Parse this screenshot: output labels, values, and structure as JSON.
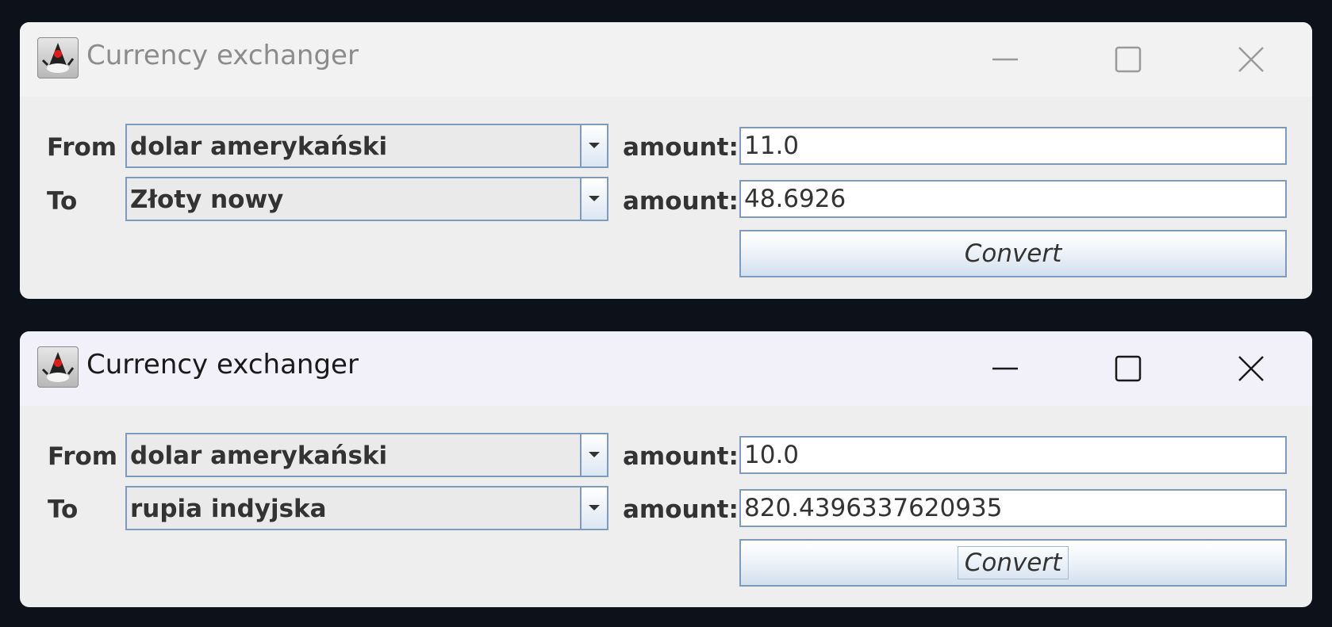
{
  "windows": [
    {
      "title": "Currency exchanger",
      "active": false,
      "from_label": "From",
      "to_label": "To",
      "from_currency": "dolar amerykański",
      "to_currency": "Złoty nowy",
      "amount_label": "amount:",
      "from_amount": "11.0",
      "to_amount": "48.6926",
      "convert_label": "Convert"
    },
    {
      "title": "Currency exchanger",
      "active": true,
      "from_label": "From",
      "to_label": "To",
      "from_currency": "dolar amerykański",
      "to_currency": "rupia indyjska",
      "amount_label": "amount:",
      "from_amount": "10.0",
      "to_amount": "820.4396337620935",
      "convert_label": "Convert"
    }
  ],
  "icons": {
    "app": "java-duke-icon",
    "minimize": "minimize-icon",
    "maximize": "maximize-icon",
    "close": "close-icon",
    "dropdown": "chevron-down-icon"
  },
  "colors": {
    "desktop": "#0d111a",
    "window_body": "#eeeeee",
    "control_border": "#7d9bbd",
    "text": "#333333"
  }
}
